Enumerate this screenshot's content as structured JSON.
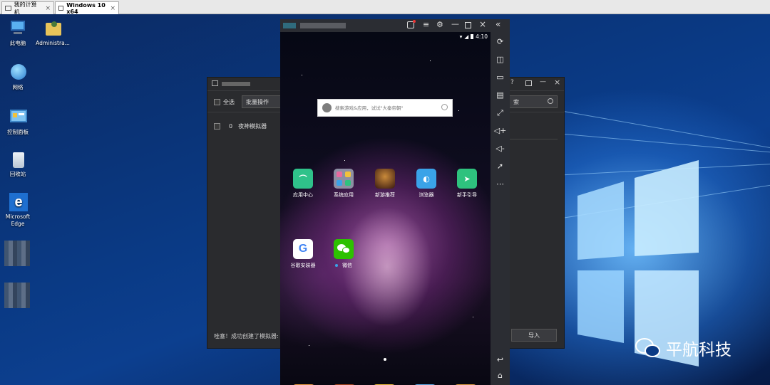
{
  "vm_tabs": [
    {
      "label": "我的计算机",
      "close": "×"
    },
    {
      "label": "Windows 10 x64",
      "close": "×"
    }
  ],
  "desktop_icons": [
    {
      "label": "此电脑",
      "icon": "computer-icon"
    },
    {
      "label": "Administra...",
      "icon": "user-folder-icon"
    },
    {
      "label": "网络",
      "icon": "network-icon"
    },
    {
      "label": "控制面板",
      "icon": "control-panel-icon"
    },
    {
      "label": "回收站",
      "icon": "recycle-bin-icon"
    },
    {
      "label": "Microsoft Edge",
      "icon": "edge-icon"
    }
  ],
  "manager": {
    "select_all": "全选",
    "batch": "批量操作",
    "row_index": "0",
    "row_name": "夜神模拟器",
    "search_placeholder": "索",
    "status": "哇塞！成功创建了模拟器:",
    "import": "导入",
    "help": "?",
    "minimize": "—",
    "close": "×"
  },
  "emulator": {
    "time": "4:10",
    "search_placeholder": "搜索游戏&应用，试试\"大秦帝朝\"",
    "apps_row1": [
      {
        "label": "应用中心",
        "color": "#2fc28a"
      },
      {
        "label": "系统应用",
        "color": "#8d8fa3"
      },
      {
        "label": "新游推荐",
        "color": "#5a3a2a"
      },
      {
        "label": "浏览器",
        "color": "#3aa3e8"
      },
      {
        "label": "新手引导",
        "color": "#2ec27e"
      }
    ],
    "apps_row2": [
      {
        "label": "谷歌安装器",
        "color": "#ffffff"
      },
      {
        "label": "微信",
        "color": "#2dc100"
      }
    ]
  },
  "brand": "平航科技",
  "colors": {
    "accent": "#2b2d33",
    "desktop": "#0a3a85"
  }
}
